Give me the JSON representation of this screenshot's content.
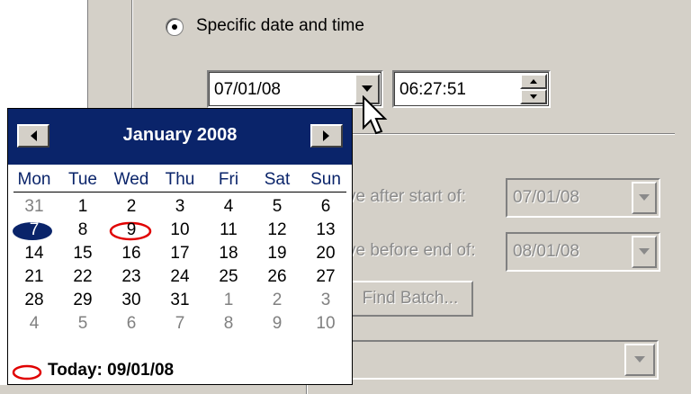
{
  "radio": {
    "label": "Specific date and time"
  },
  "date_field": {
    "value": "07/01/08"
  },
  "time_field": {
    "value": "06:27:51"
  },
  "filter": {
    "after_label": "ve after start of:",
    "after_value": "07/01/08",
    "before_label": "ve before end of:",
    "before_value": "08/01/08",
    "find_button": "Find Batch..."
  },
  "calendar": {
    "title": "January 2008",
    "days_of_week": [
      "Mon",
      "Tue",
      "Wed",
      "Thu",
      "Fri",
      "Sat",
      "Sun"
    ],
    "weeks": [
      [
        {
          "d": "31",
          "o": true
        },
        {
          "d": "1"
        },
        {
          "d": "2"
        },
        {
          "d": "3"
        },
        {
          "d": "4"
        },
        {
          "d": "5"
        },
        {
          "d": "6"
        }
      ],
      [
        {
          "d": "7",
          "sel": true
        },
        {
          "d": "8"
        },
        {
          "d": "9",
          "today": true
        },
        {
          "d": "10"
        },
        {
          "d": "11"
        },
        {
          "d": "12"
        },
        {
          "d": "13"
        }
      ],
      [
        {
          "d": "14"
        },
        {
          "d": "15"
        },
        {
          "d": "16"
        },
        {
          "d": "17"
        },
        {
          "d": "18"
        },
        {
          "d": "19"
        },
        {
          "d": "20"
        }
      ],
      [
        {
          "d": "21"
        },
        {
          "d": "22"
        },
        {
          "d": "23"
        },
        {
          "d": "24"
        },
        {
          "d": "25"
        },
        {
          "d": "26"
        },
        {
          "d": "27"
        }
      ],
      [
        {
          "d": "28"
        },
        {
          "d": "29"
        },
        {
          "d": "30"
        },
        {
          "d": "31"
        },
        {
          "d": "1",
          "o": true
        },
        {
          "d": "2",
          "o": true
        },
        {
          "d": "3",
          "o": true
        }
      ],
      [
        {
          "d": "4",
          "o": true
        },
        {
          "d": "5",
          "o": true
        },
        {
          "d": "6",
          "o": true
        },
        {
          "d": "7",
          "o": true
        },
        {
          "d": "8",
          "o": true
        },
        {
          "d": "9",
          "o": true
        },
        {
          "d": "10",
          "o": true
        }
      ]
    ],
    "today_label": "Today: 09/01/08"
  },
  "colors": {
    "header_bg": "#0a246a",
    "selected_day": "#0a246a",
    "today_circle": "#e00000",
    "window_bg": "#d4d0c8"
  },
  "icons": {
    "prev": "triangle-left",
    "next": "triangle-right",
    "dropdown": "triangle-down",
    "cursor": "arrow-pointer"
  }
}
